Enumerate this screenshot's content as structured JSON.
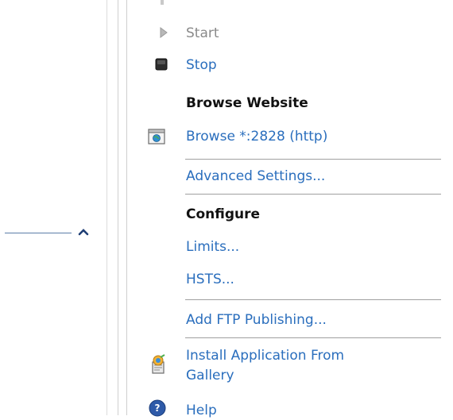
{
  "actions": {
    "start_label": "Start",
    "stop_label": "Stop",
    "browse_header": "Browse Website",
    "browse_link": "Browse *:2828 (http)",
    "advanced_settings": "Advanced Settings...",
    "configure_header": "Configure",
    "limits": "Limits...",
    "hsts": "HSTS...",
    "add_ftp": "Add FTP Publishing...",
    "install_app_line1": "Install Application From",
    "install_app_line2": "Gallery",
    "help": "Help"
  },
  "colors": {
    "link": "#2a6ebd",
    "disabled": "#8a8a8a",
    "header": "#111111"
  },
  "icons": {
    "start": "play-icon",
    "stop": "stop-icon",
    "browse": "browser-window-icon",
    "install": "install-package-icon",
    "help": "help-icon",
    "collapse": "chevron-up-icon"
  }
}
